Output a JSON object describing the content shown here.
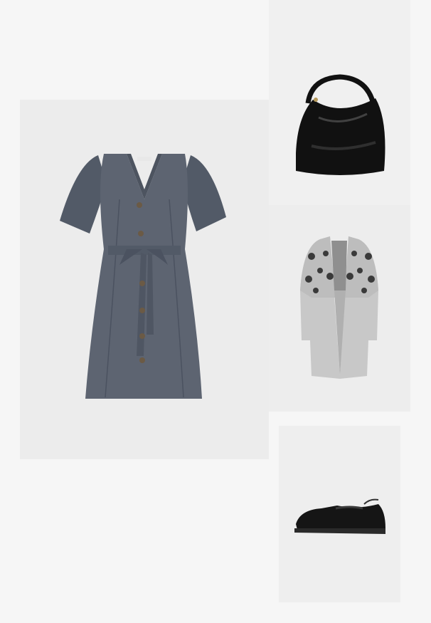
{
  "items": [
    {
      "name": "dress",
      "description_color": "#5d6471"
    },
    {
      "name": "shoulder-bag",
      "description_color": "#111111"
    },
    {
      "name": "cardigan",
      "description_color": "#c8c8c8"
    },
    {
      "name": "loafer",
      "description_color": "#151515"
    }
  ],
  "colors": {
    "page_background": "#f6f6f6",
    "tile_background": "#ececec",
    "dress": "#5d6471",
    "bag": "#111111",
    "cardigan": "#c8c8c8",
    "leopard_print": "#3a3a3a",
    "loafer": "#151515"
  }
}
